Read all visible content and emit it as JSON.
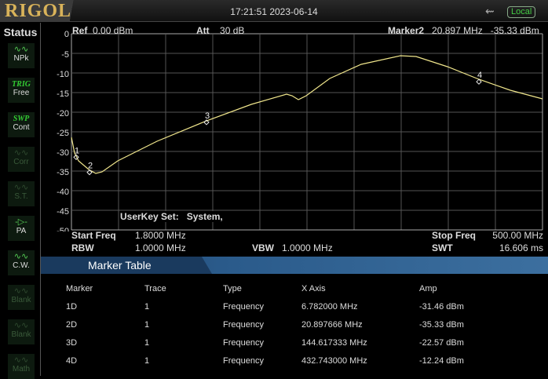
{
  "header": {
    "logo": "RIGOL",
    "datetime": "17:21:51 2023-06-14",
    "usb_icon": "usb-icon",
    "remote_status": "Local"
  },
  "sidebar": {
    "title": "Status",
    "items": [
      {
        "icon": "NPk",
        "label": "NPk",
        "dim": false
      },
      {
        "tag": "TRIG",
        "label": "Free",
        "dim": false
      },
      {
        "tag": "SWP",
        "label": "Cont",
        "dim": false
      },
      {
        "icon": "Corr",
        "label": "Corr",
        "dim": true
      },
      {
        "icon": "S.T.",
        "label": "S.T.",
        "dim": true
      },
      {
        "icon": "PA",
        "label": "PA",
        "dim": false
      },
      {
        "icon": "C.W.",
        "label": "C.W.",
        "dim": false
      },
      {
        "icon": "Blank",
        "label": "Blank",
        "dim": true
      },
      {
        "icon": "Blank",
        "label": "Blank",
        "dim": true
      },
      {
        "icon": "Math",
        "label": "Math",
        "dim": true
      }
    ]
  },
  "display": {
    "ref_label": "Ref",
    "ref_value": "0.00 dBm",
    "att_label": "Att",
    "att_value": "30 dB",
    "marker_label": "Marker2",
    "marker_freq": "20.897 MHz",
    "marker_amp": "-35.33 dBm",
    "userkey_label": "UserKey Set:",
    "userkey_value": "System,"
  },
  "sweep": {
    "start_label": "Start Freq",
    "start_value": "1.8000 MHz",
    "stop_label": "Stop Freq",
    "stop_value": "500.00 MHz",
    "rbw_label": "RBW",
    "rbw_value": "1.0000 MHz",
    "vbw_label": "VBW",
    "vbw_value": "1.0000 MHz",
    "swt_label": "SWT",
    "swt_value": "16.606 ms"
  },
  "chart_data": {
    "type": "line",
    "xlim": [
      1.8,
      500
    ],
    "ylim": [
      -50,
      0
    ],
    "y_ticks": [
      "0",
      "-5",
      "-10",
      "-15",
      "-20",
      "-25",
      "-30",
      "-35",
      "-40",
      "-45",
      "-50"
    ],
    "grid": true,
    "trace_color": "#f0e68c",
    "trace": [
      [
        1.8,
        -26.4
      ],
      [
        5.1,
        -30.4
      ],
      [
        9.3,
        -32.4
      ],
      [
        20.1,
        -34.6
      ],
      [
        27.5,
        -35.6
      ],
      [
        34.2,
        -35.2
      ],
      [
        50.8,
        -32.4
      ],
      [
        92.3,
        -27.4
      ],
      [
        144.6,
        -22.2
      ],
      [
        192,
        -18
      ],
      [
        229.3,
        -15.4
      ],
      [
        235.1,
        -15.8
      ],
      [
        241.8,
        -16.8
      ],
      [
        250.1,
        -15.8
      ],
      [
        275,
        -11.4
      ],
      [
        308.2,
        -7.8
      ],
      [
        349.7,
        -5.6
      ],
      [
        366.3,
        -5.8
      ],
      [
        399.5,
        -8.4
      ],
      [
        432.7,
        -11.6
      ],
      [
        465.9,
        -14.4
      ],
      [
        500,
        -16.6
      ]
    ],
    "markers": [
      {
        "label": "1",
        "x": 6.782,
        "y": -31.46
      },
      {
        "label": "2",
        "x": 20.897666,
        "y": -35.33
      },
      {
        "label": "3",
        "x": 144.617333,
        "y": -22.57
      },
      {
        "label": "4",
        "x": 432.743,
        "y": -12.24
      }
    ]
  },
  "marker_table": {
    "title": "Marker Table",
    "columns": [
      "Marker",
      "Trace",
      "Type",
      "X Axis",
      "Amp"
    ],
    "rows": [
      [
        "1D",
        "1",
        "Frequency",
        "6.782000 MHz",
        "-31.46 dBm"
      ],
      [
        "2D",
        "1",
        "Frequency",
        "20.897666 MHz",
        "-35.33 dBm"
      ],
      [
        "3D",
        "1",
        "Frequency",
        "144.617333 MHz",
        "-22.57 dBm"
      ],
      [
        "4D",
        "1",
        "Frequency",
        "432.743000 MHz",
        "-12.24 dBm"
      ]
    ]
  }
}
